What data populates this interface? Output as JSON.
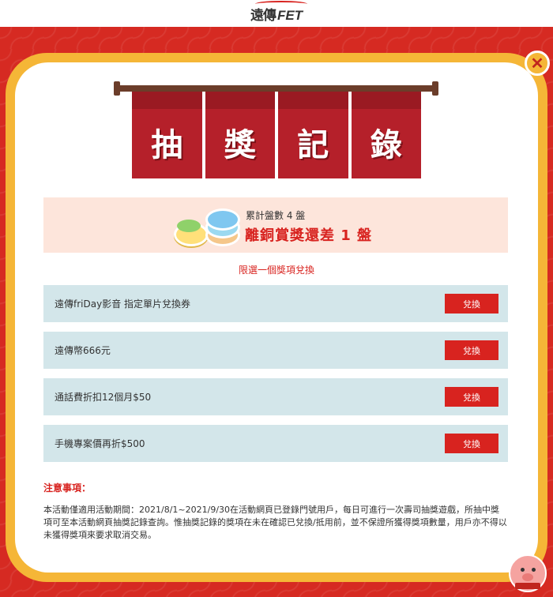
{
  "header": {
    "brand_cjk": "遠傳",
    "brand_latin": "FET"
  },
  "banner": {
    "chars": [
      "抽",
      "獎",
      "記",
      "錄"
    ]
  },
  "counter": {
    "count_text": "累計盤數 4 盤",
    "remaining_text": "離銅賞獎還差 1 盤"
  },
  "choose_one": "限選一個獎項兌換",
  "prizes": [
    {
      "name": "遠傳friDay影音 指定單片兌換券",
      "button": "兌換"
    },
    {
      "name": "遠傳幣666元",
      "button": "兌換"
    },
    {
      "name": "通話費折扣12個月$50",
      "button": "兌換"
    },
    {
      "name": "手機專案價再折$500",
      "button": "兌換"
    }
  ],
  "notes": {
    "title": "注意事項：",
    "body": "本活動僅適用活動期間：2021/8/1~2021/9/30在活動網頁已登錄門號用戶，每日可進行一次壽司抽獎遊戲，所抽中獎項可至本活動網頁抽獎記錄查詢。惟抽獎記錄的獎項在未在確認已兌換/抵用前，並不保證所獲得獎項數量，用戶亦不得以未獲得獎項來要求取消交易。"
  },
  "colors": {
    "accent": "#d8231f",
    "frame": "#f5b637",
    "row_bg": "#d3e6ea",
    "counter_bg": "#fde5db"
  }
}
